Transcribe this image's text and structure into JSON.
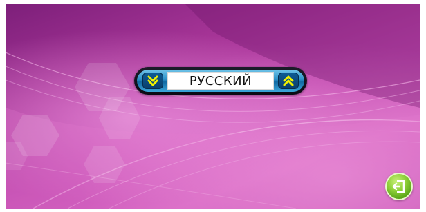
{
  "language_selector": {
    "current_language": "РУССКИЙ",
    "prev_icon": "double-chevron-down-icon",
    "next_icon": "double-chevron-up-icon"
  },
  "back_button": {
    "icon": "return-back-icon"
  },
  "colors": {
    "background_primary": "#a53496",
    "background_light": "#d35fc0",
    "selector_accent": "#2a8fc6",
    "arrow_color": "#f2f200",
    "back_button": "#8fd03a"
  }
}
